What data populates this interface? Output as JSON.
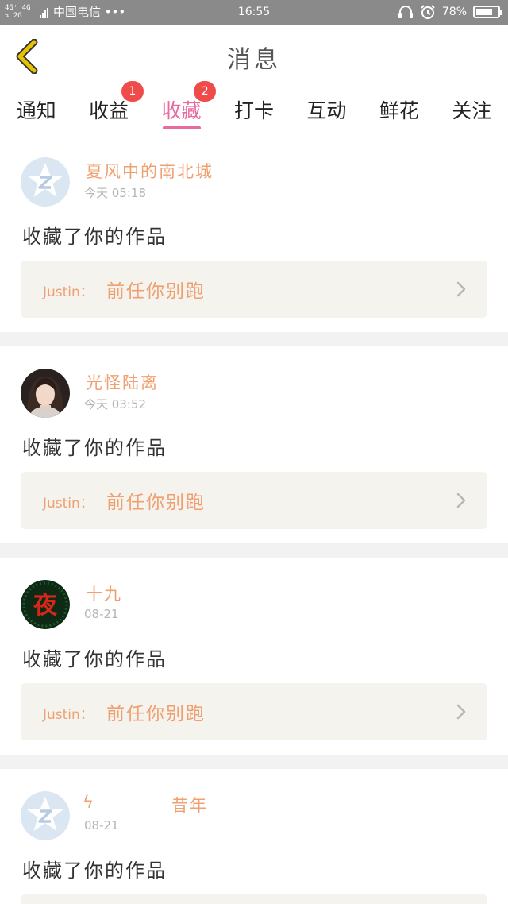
{
  "status_bar": {
    "signal_top": "4G⁺ 4G⁺",
    "signal_bottom": "⇅ 2G",
    "carrier": "中国电信 •••",
    "time": "16:55",
    "battery": "78%",
    "battery_level": 0.78
  },
  "header": {
    "title": "消息"
  },
  "tabs": [
    {
      "label": "通知",
      "badge": "",
      "active": false
    },
    {
      "label": "收益",
      "badge": "1",
      "active": false
    },
    {
      "label": "收藏",
      "badge": "2",
      "active": true
    },
    {
      "label": "打卡",
      "badge": "",
      "active": false
    },
    {
      "label": "互动",
      "badge": "",
      "active": false
    },
    {
      "label": "鲜花",
      "badge": "",
      "active": false
    },
    {
      "label": "关注",
      "badge": "",
      "active": false
    }
  ],
  "items": [
    {
      "name": "夏风中的南北城",
      "time": "今天 05:18",
      "action": "收藏了你的作品",
      "work_author": "Justin：",
      "work_title": "前任你别跑",
      "avatar": "default-avatar-icon"
    },
    {
      "name": "光怪陆离",
      "time": "今天 03:52",
      "action": "收藏了你的作品",
      "work_author": "Justin：",
      "work_title": "前任你别跑",
      "avatar": "photo-avatar"
    },
    {
      "name": "十九",
      "time": "08-21",
      "action": "收藏了你的作品",
      "work_author": "Justin：",
      "work_title": "前任你别跑",
      "avatar": "calligraphy-avatar"
    },
    {
      "name_part1": "ϟ",
      "name_part2": "昔年",
      "time": "08-21",
      "action": "收藏了你的作品",
      "avatar": "default-avatar-icon"
    }
  ],
  "avatar_glyph": "夜",
  "colors": {
    "accent_pink": "#e86aa0",
    "name_orange": "#f0a070",
    "badge_red": "#f04b4b",
    "work_bg": "#f4f3ee",
    "back_arrow": "#e6c200"
  }
}
